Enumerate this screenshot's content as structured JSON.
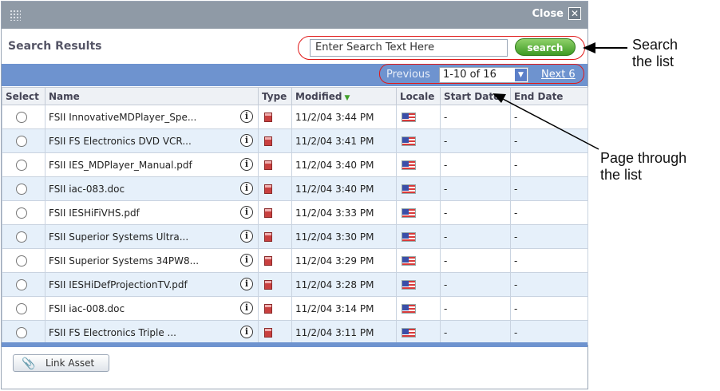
{
  "window": {
    "close_label": "Close"
  },
  "header": {
    "title": "Search Results"
  },
  "search": {
    "placeholder": "Enter Search Text Here",
    "button_label": "search"
  },
  "pager": {
    "previous_label": "Previous",
    "range_value": "1-10 of 16",
    "next_label": "Next 6"
  },
  "table": {
    "columns": [
      "Select",
      "Name",
      "Type",
      "Modified",
      "Locale",
      "Start Date",
      "End Date"
    ],
    "rows": [
      {
        "name": "FSII InnovativeMDPlayer_Spe...",
        "modified": "11/2/04 3:44 PM",
        "start": "-",
        "end": "-"
      },
      {
        "name": "FSII FS Electronics DVD VCR...",
        "modified": "11/2/04 3:41 PM",
        "start": "-",
        "end": "-"
      },
      {
        "name": "FSII IES_MDPlayer_Manual.pdf",
        "modified": "11/2/04 3:40 PM",
        "start": "-",
        "end": "-"
      },
      {
        "name": "FSII iac-083.doc",
        "modified": "11/2/04 3:40 PM",
        "start": "-",
        "end": "-"
      },
      {
        "name": "FSII IESHiFiVHS.pdf",
        "modified": "11/2/04 3:33 PM",
        "start": "-",
        "end": "-"
      },
      {
        "name": "FSII Superior Systems Ultra...",
        "modified": "11/2/04 3:30 PM",
        "start": "-",
        "end": "-"
      },
      {
        "name": "FSII Superior Systems 34PW8...",
        "modified": "11/2/04 3:29 PM",
        "start": "-",
        "end": "-"
      },
      {
        "name": "FSII IESHiDefProjectionTV.pdf",
        "modified": "11/2/04 3:28 PM",
        "start": "-",
        "end": "-"
      },
      {
        "name": "FSII iac-008.doc",
        "modified": "11/2/04 3:14 PM",
        "start": "-",
        "end": "-"
      },
      {
        "name": "FSII FS Electronics Triple ...",
        "modified": "11/2/04 3:11 PM",
        "start": "-",
        "end": "-"
      }
    ]
  },
  "footer": {
    "link_asset_label": "Link Asset"
  },
  "callouts": {
    "search_line1": "Search",
    "search_line2": "the list",
    "page_line1": "Page through",
    "page_line2": "the list"
  },
  "colors": {
    "titlebar": "#8f9aa6",
    "pager_bar": "#6e93cf",
    "row_alt": "#e6f0fa",
    "search_button": "#3e9a23",
    "highlight_ring": "#e01818"
  },
  "icons": {
    "grip": "grip-icon",
    "close": "close-icon",
    "info": "info-icon",
    "type": "document-type-icon",
    "locale": "us-flag-icon",
    "link": "paperclip-icon",
    "sort": "sort-descending-icon"
  }
}
